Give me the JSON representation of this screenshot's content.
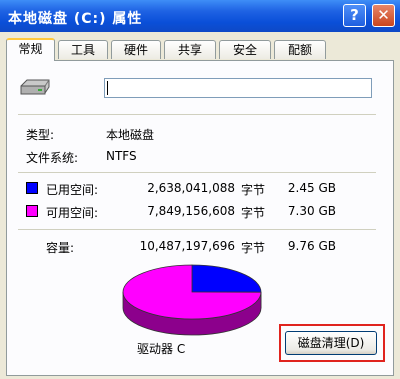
{
  "window": {
    "title": "本地磁盘 (C:) 属性",
    "help_glyph": "?",
    "close_glyph": "✕"
  },
  "tabs": [
    {
      "label": "常规",
      "active": true
    },
    {
      "label": "工具"
    },
    {
      "label": "硬件"
    },
    {
      "label": "共享"
    },
    {
      "label": "安全"
    },
    {
      "label": "配额"
    }
  ],
  "general": {
    "drive_name_value": "",
    "type_label": "类型:",
    "type_value": "本地磁盘",
    "fs_label": "文件系统:",
    "fs_value": "NTFS",
    "used": {
      "label": "已用空间:",
      "bytes": "2,638,041,088",
      "unit": "字节",
      "size": "2.45 GB",
      "color": "#0000FF"
    },
    "free": {
      "label": "可用空间:",
      "bytes": "7,849,156,608",
      "unit": "字节",
      "size": "7.30 GB",
      "color": "#FF00FF"
    },
    "capacity": {
      "label": "容量:",
      "bytes": "10,487,197,696",
      "unit": "字节",
      "size": "9.76 GB"
    },
    "drive_label": "驱动器 C",
    "cleanup_button": "磁盘清理(D)"
  },
  "chart_data": {
    "type": "pie",
    "slices": [
      {
        "name": "已用空间",
        "value": 2.45,
        "color": "#0000FF"
      },
      {
        "name": "可用空间",
        "value": 7.3,
        "color": "#FF00FF"
      }
    ]
  }
}
